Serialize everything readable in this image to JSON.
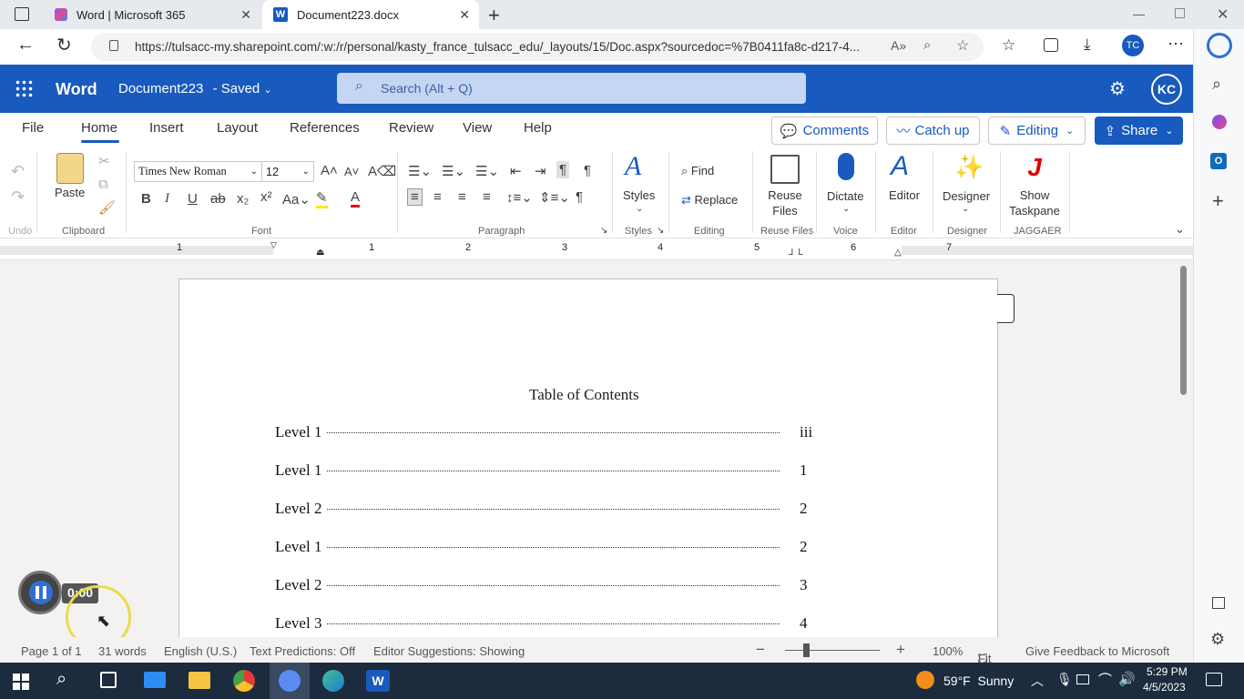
{
  "browser": {
    "tabs": [
      {
        "label": "Word | Microsoft 365",
        "icon": "m365-icon"
      },
      {
        "label": "Document223.docx",
        "icon": "word-icon"
      }
    ],
    "url": "https://tulsacc-my.sharepoint.com/:w:/r/personal/kasty_france_tulsacc_edu/_layouts/15/Doc.aspx?sourcedoc=%7B0411fa8c-d217-4..."
  },
  "word": {
    "app_name": "Word",
    "doc_title": "Document223",
    "save_status": "-  Saved",
    "search_placeholder": "Search (Alt + Q)",
    "avatar_initials": "KC"
  },
  "menu": {
    "tabs": [
      "File",
      "Home",
      "Insert",
      "Layout",
      "References",
      "Review",
      "View",
      "Help"
    ],
    "active_tab": "Home",
    "comments": "Comments",
    "catchup": "Catch up",
    "editing": "Editing",
    "share": "Share"
  },
  "ribbon": {
    "undo_label": "Undo",
    "clipboard_label": "Clipboard",
    "paste": "Paste",
    "font_label": "Font",
    "font_name": "Times New Roman",
    "font_size": "12",
    "paragraph_label": "Paragraph",
    "styles": "Styles",
    "styles_label": "Styles",
    "find": "Find",
    "replace": "Replace",
    "editing_label": "Editing",
    "reuse_files": "Reuse Files",
    "reuse_files_label": "Reuse Files",
    "dictate": "Dictate",
    "voice_label": "Voice",
    "editor": "Editor",
    "editor_label": "Editor",
    "designer": "Designer",
    "designer_label": "Designer",
    "show_taskpane": "Show Taskpane",
    "jaggaer_label": "JAGGAER"
  },
  "ruler": [
    "1",
    "1",
    "2",
    "3",
    "4",
    "5",
    "6",
    "7"
  ],
  "document": {
    "heading": "Table of Contents",
    "entries": [
      {
        "label": "Level 1",
        "page": "iii"
      },
      {
        "label": "Level 1",
        "page": "1"
      },
      {
        "label": "Level 2",
        "page": "2"
      },
      {
        "label": "Level 1",
        "page": "2"
      },
      {
        "label": "Level 2",
        "page": "3"
      },
      {
        "label": "Level 3",
        "page": "4"
      }
    ]
  },
  "recorder": {
    "time": "0:00"
  },
  "status": {
    "page": "Page 1 of 1",
    "words": "31 words",
    "language": "English (U.S.)",
    "predictions": "Text Predictions: Off",
    "suggestions": "Editor Suggestions: Showing",
    "zoom": "100%",
    "fit": "Fit",
    "feedback": "Give Feedback to Microsoft"
  },
  "taskbar": {
    "weather": "59°F  Sunny",
    "time": "5:29 PM",
    "date": "4/5/2023"
  },
  "colors": {
    "word_blue": "#185abd",
    "taskbar": "#1c2b3e"
  }
}
